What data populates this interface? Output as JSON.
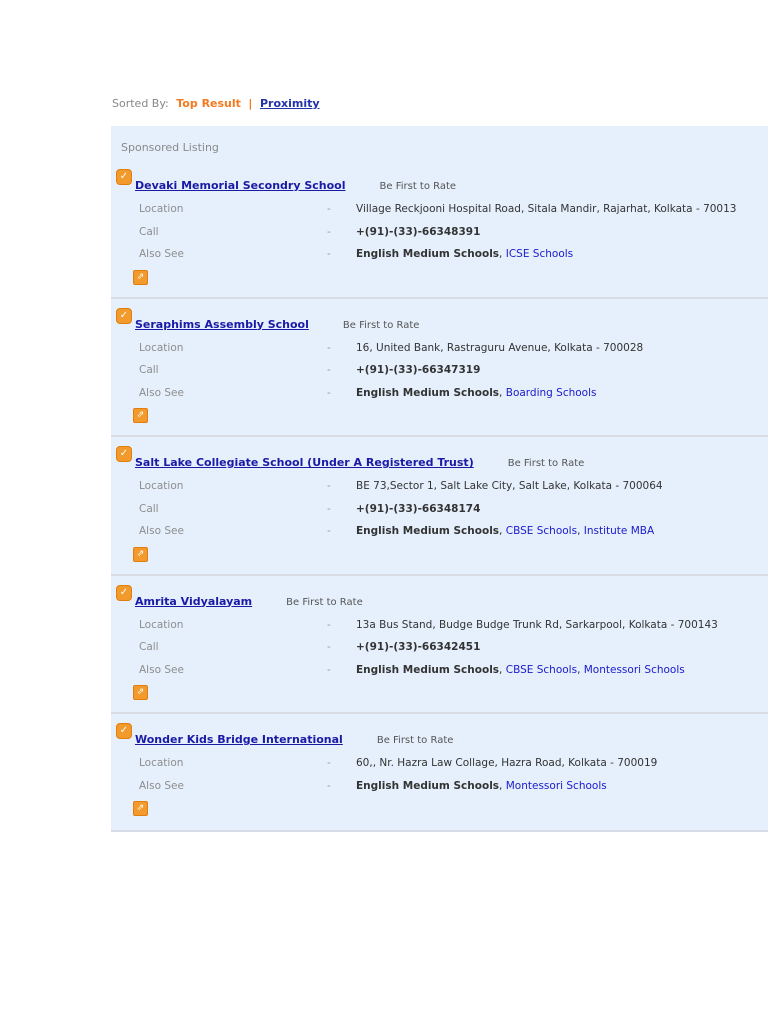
{
  "sort": {
    "label": "Sorted By:",
    "active": "Top Result",
    "separator": "|",
    "option": "Proximity"
  },
  "panel": {
    "heading": "Sponsored Listing"
  },
  "listings": [
    {
      "name": "Devaki Memorial Secondry School",
      "rating": "Be First to Rate",
      "rows": [
        {
          "label": "Location",
          "dash": "-",
          "value": "Village Reckjooni Hospital Road, Sitala Mandir, Rajarhat, Kolkata - 70013"
        },
        {
          "label": "Call",
          "dash": "-",
          "value": "+(91)-(33)-66348391",
          "bold": true
        },
        {
          "label": "Also See",
          "dash": "-",
          "value": "English Medium Schools",
          "bold": true,
          "links": [
            "ICSE Schools"
          ]
        }
      ]
    },
    {
      "name": "Seraphims Assembly School",
      "rating": "Be First to Rate",
      "rows": [
        {
          "label": "Location",
          "dash": "-",
          "value": "16, United Bank, Rastraguru Avenue, Kolkata - 700028"
        },
        {
          "label": "Call",
          "dash": "-",
          "value": "+(91)-(33)-66347319",
          "bold": true
        },
        {
          "label": "Also See",
          "dash": "-",
          "value": "English Medium Schools",
          "bold": true,
          "links": [
            "Boarding Schools"
          ]
        }
      ]
    },
    {
      "name": "Salt Lake Collegiate School (Under A Registered Trust)",
      "rating": "Be First to Rate",
      "rows": [
        {
          "label": "Location",
          "dash": "-",
          "value": "BE 73,Sector 1, Salt Lake City, Salt Lake, Kolkata - 700064"
        },
        {
          "label": "Call",
          "dash": "-",
          "value": "+(91)-(33)-66348174",
          "bold": true
        },
        {
          "label": "Also See",
          "dash": "-",
          "value": "English Medium Schools",
          "bold": true,
          "links": [
            "CBSE Schools",
            "Institute MBA"
          ]
        }
      ]
    },
    {
      "name": "Amrita Vidyalayam",
      "rating": "Be First to Rate",
      "rows": [
        {
          "label": "Location",
          "dash": "-",
          "value": "13a Bus Stand, Budge Budge Trunk Rd, Sarkarpool, Kolkata - 700143"
        },
        {
          "label": "Call",
          "dash": "-",
          "value": "+(91)-(33)-66342451",
          "bold": true
        },
        {
          "label": "Also See",
          "dash": "-",
          "value": "English Medium Schools",
          "bold": true,
          "links": [
            "CBSE Schools",
            "Montessori Schools"
          ]
        }
      ]
    },
    {
      "name": "Wonder Kids Bridge International",
      "rating": "Be First to Rate",
      "rows": [
        {
          "label": "Location",
          "dash": "-",
          "value": "60,, Nr. Hazra Law Collage, Hazra Road, Kolkata - 700019"
        },
        {
          "label": "Also See",
          "dash": "-",
          "value": "English Medium Schools",
          "bold": true,
          "links": [
            "Montessori Schools"
          ]
        }
      ]
    }
  ],
  "colors": {
    "accent": "#f47a20",
    "link": "#1a1aa6",
    "panel": "#e6f0fc"
  }
}
